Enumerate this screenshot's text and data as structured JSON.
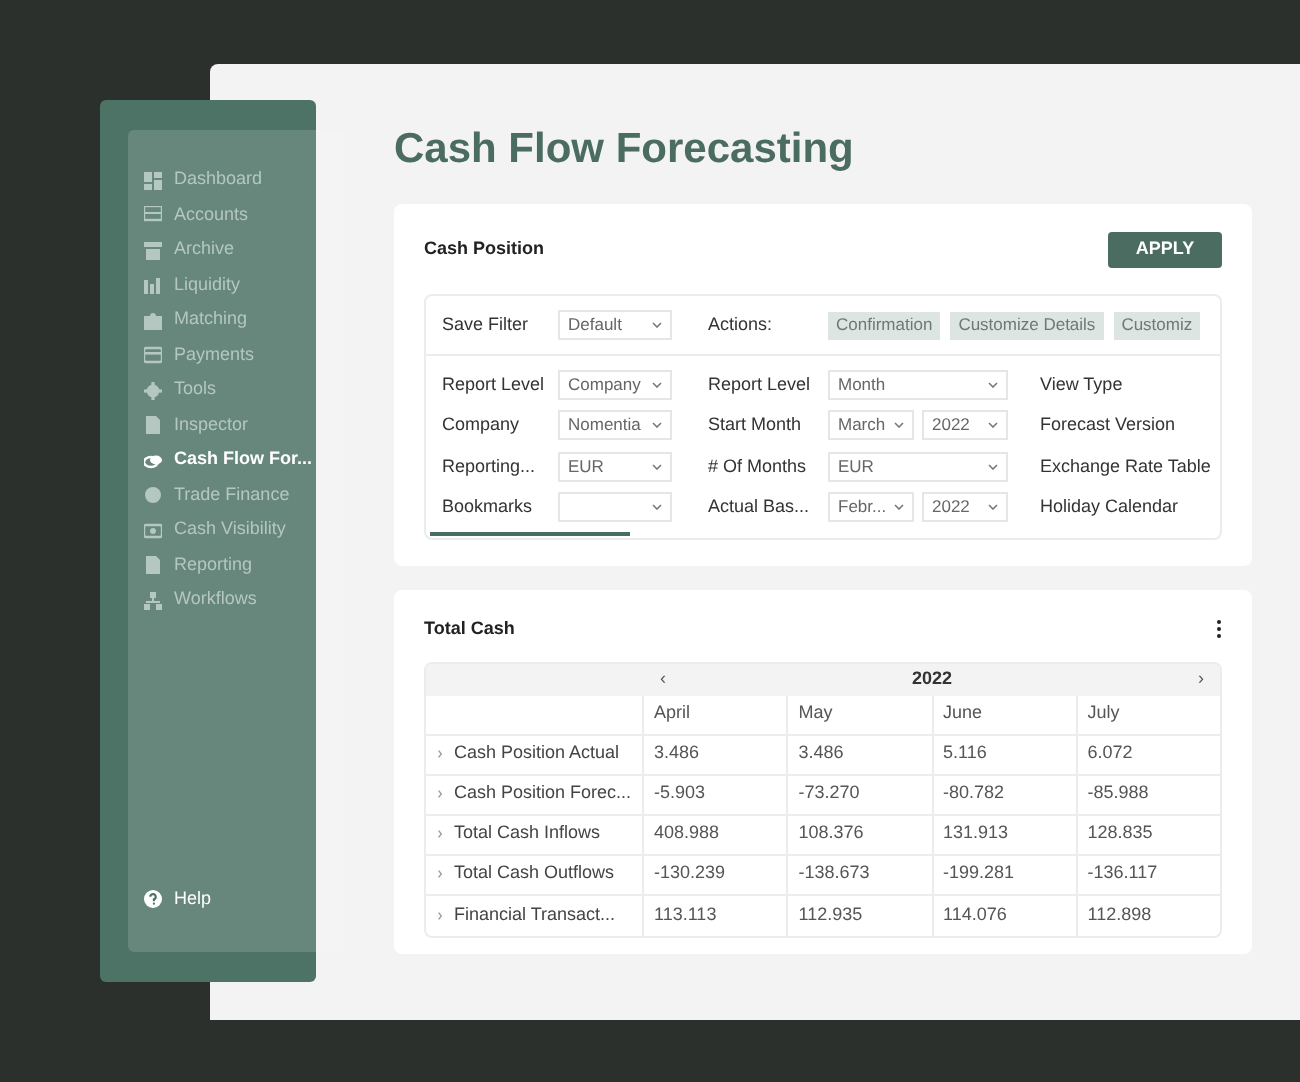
{
  "sidebar": {
    "items": [
      {
        "label": "Dashboard",
        "selected": false
      },
      {
        "label": "Accounts",
        "selected": false
      },
      {
        "label": "Archive",
        "selected": false
      },
      {
        "label": "Liquidity",
        "selected": false
      },
      {
        "label": "Matching",
        "selected": false
      },
      {
        "label": "Payments",
        "selected": false
      },
      {
        "label": "Tools",
        "selected": false
      },
      {
        "label": "Inspector",
        "selected": false
      },
      {
        "label": "Cash Flow For...",
        "selected": true
      },
      {
        "label": "Trade Finance",
        "selected": false
      },
      {
        "label": "Cash Visibility",
        "selected": false
      },
      {
        "label": "Reporting",
        "selected": false
      },
      {
        "label": "Workflows",
        "selected": false
      }
    ],
    "help": "Help"
  },
  "page_title": "Cash Flow Forecasting",
  "cash_position": {
    "title": "Cash Position",
    "apply_button": "APPLY",
    "save_filter": {
      "label": "Save Filter",
      "value": "Default"
    },
    "actions": {
      "label": "Actions:",
      "buttons": [
        "Confirmation",
        "Customize Details",
        "Customiz"
      ]
    },
    "rows": [
      {
        "fields": [
          {
            "label": "Report Level",
            "selects": [
              {
                "kind": "dropdown",
                "value": "Company"
              }
            ]
          },
          {
            "label": "Report Level",
            "selects": [
              {
                "kind": "dropdown",
                "value": "Month"
              }
            ]
          },
          {
            "label": "View Type"
          }
        ]
      },
      {
        "fields": [
          {
            "label": "Company",
            "selects": [
              {
                "kind": "dropdown",
                "value": "Nomentia"
              }
            ]
          },
          {
            "label": "Start Month",
            "selects": [
              {
                "kind": "dropdown",
                "value": "March"
              },
              {
                "kind": "dropdown",
                "value": "2022"
              }
            ]
          },
          {
            "label": "Forecast Version"
          }
        ]
      },
      {
        "fields": [
          {
            "label": "Reporting...",
            "selects": [
              {
                "kind": "dropdown",
                "value": "EUR"
              }
            ]
          },
          {
            "label": "# Of Months",
            "selects": [
              {
                "kind": "dropdown",
                "value": "EUR"
              }
            ]
          },
          {
            "label": "Exchange Rate Table"
          }
        ]
      },
      {
        "fields": [
          {
            "label": "Bookmarks",
            "selects": [
              {
                "kind": "dropdown"
              }
            ]
          },
          {
            "label": "Actual Bas...",
            "selects": [
              {
                "kind": "dropdown",
                "value": "Febr..."
              },
              {
                "kind": "dropdown",
                "value": "2022"
              }
            ]
          },
          {
            "label": "Holiday Calendar"
          }
        ]
      }
    ]
  },
  "total_cash": {
    "title": "Total Cash",
    "year": "2022",
    "prev": "‹",
    "next": "›",
    "columns": [
      "April",
      "May",
      "June",
      "July"
    ],
    "rows": [
      {
        "label": "Cash Position Actual",
        "values": [
          "3.486",
          "3.486",
          "5.116",
          "6.072"
        ]
      },
      {
        "label": "Cash Position Forec...",
        "values": [
          "-5.903",
          "-73.270",
          "-80.782",
          "-85.988"
        ]
      },
      {
        "label": "Total Cash Inflows",
        "values": [
          "408.988",
          "108.376",
          "131.913",
          "128.835"
        ]
      },
      {
        "label": "Total Cash Outflows",
        "values": [
          "-130.239",
          "-138.673",
          "-199.281",
          "-136.117"
        ]
      },
      {
        "label": "Financial Transact...",
        "values": [
          "113.113",
          "112.935",
          "114.076",
          "112.898"
        ]
      }
    ]
  }
}
